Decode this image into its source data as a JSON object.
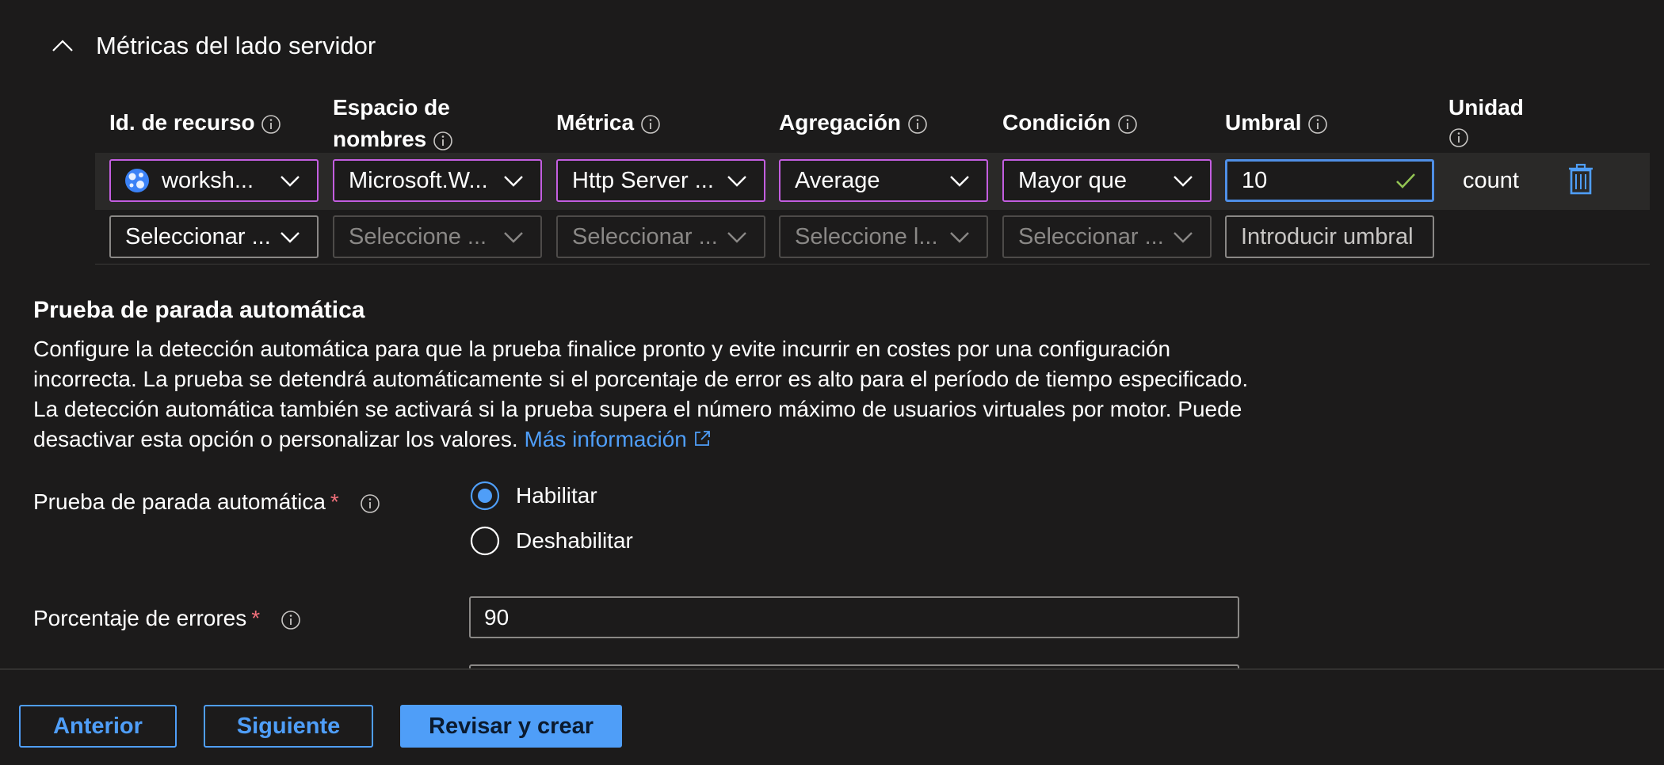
{
  "section": {
    "title": "Métricas del lado servidor"
  },
  "columns": {
    "resource_id": "Id. de recurso",
    "namespace_line1": "Espacio de",
    "namespace_line2": "nombres",
    "metric": "Métrica",
    "aggregation": "Agregación",
    "condition": "Condición",
    "threshold": "Umbral",
    "unit": "Unidad"
  },
  "row1": {
    "resource": "worksh...",
    "namespace": "Microsoft.W...",
    "metric": "Http Server ...",
    "aggregation": "Average",
    "condition": "Mayor que",
    "threshold": "10",
    "unit": "count"
  },
  "row2": {
    "resource_placeholder": "Seleccionar ...",
    "namespace_placeholder": "Seleccione ...",
    "metric_placeholder": "Seleccionar ...",
    "aggregation_placeholder": "Seleccione l...",
    "condition_placeholder": "Seleccionar ...",
    "threshold_placeholder": "Introducir umbral"
  },
  "autostop": {
    "heading": "Prueba de parada automática",
    "description": "Configure la detección automática para que la prueba finalice pronto y evite incurrir en costes por una configuración incorrecta. La prueba se detendrá automáticamente si el porcentaje de error es alto para el período de tiempo especificado. La detección automática también se activará si la prueba supera el número máximo de usuarios virtuales por motor. Puede desactivar esta opción o personalizar los valores.",
    "learn_more": "Más información",
    "field_label": "Prueba de parada automática",
    "required_mark": "*",
    "options": [
      "Habilitar",
      "Deshabilitar"
    ],
    "selected": "Habilitar",
    "error_label": "Porcentaje de errores",
    "error_value": "90"
  },
  "footer": {
    "previous": "Anterior",
    "next": "Siguiente",
    "review": "Revisar y crear"
  },
  "colors": {
    "accent": "#4f9ef8",
    "selected_border": "#c35ee0",
    "required": "#f1707b",
    "valid_check": "#92c353",
    "background": "#1c1b1b"
  }
}
